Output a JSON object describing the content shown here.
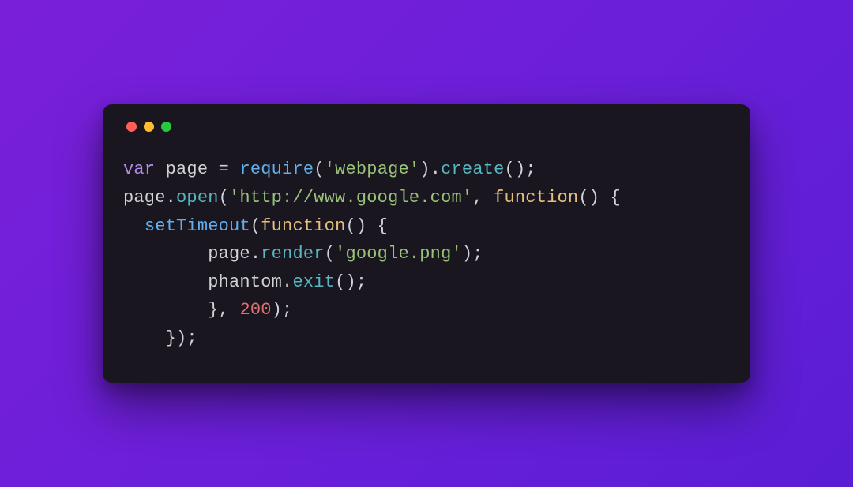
{
  "colors": {
    "background_gradient_from": "#7a1fd9",
    "background_gradient_to": "#5a1dd4",
    "window_bg": "#1a161f",
    "traffic_red": "#ff5f57",
    "traffic_yellow": "#febc2e",
    "traffic_green": "#28c840",
    "token_keyword": "#b389ed",
    "token_ident": "#d0d2d6",
    "token_method": "#56b6c2",
    "token_builtin": "#61afef",
    "token_fnword": "#e5c07b",
    "token_string": "#98c379",
    "token_number": "#d8716f",
    "token_punc": "#cfd2d8"
  },
  "code": {
    "language": "javascript",
    "lines": [
      [
        {
          "t": "keyword",
          "v": "var"
        },
        {
          "t": "punc",
          "v": " "
        },
        {
          "t": "ident",
          "v": "page"
        },
        {
          "t": "punc",
          "v": " "
        },
        {
          "t": "punc",
          "v": "="
        },
        {
          "t": "punc",
          "v": " "
        },
        {
          "t": "builtin",
          "v": "require"
        },
        {
          "t": "punc",
          "v": "("
        },
        {
          "t": "string",
          "v": "'webpage'"
        },
        {
          "t": "punc",
          "v": ")"
        },
        {
          "t": "punc",
          "v": "."
        },
        {
          "t": "method",
          "v": "create"
        },
        {
          "t": "punc",
          "v": "();"
        }
      ],
      [
        {
          "t": "ident",
          "v": "page"
        },
        {
          "t": "punc",
          "v": "."
        },
        {
          "t": "method",
          "v": "open"
        },
        {
          "t": "punc",
          "v": "("
        },
        {
          "t": "string",
          "v": "'http://www.google.com'"
        },
        {
          "t": "punc",
          "v": ", "
        },
        {
          "t": "fnword",
          "v": "function"
        },
        {
          "t": "punc",
          "v": "() {"
        }
      ],
      [
        {
          "t": "punc",
          "v": "  "
        },
        {
          "t": "method2",
          "v": "setTimeout"
        },
        {
          "t": "punc",
          "v": "("
        },
        {
          "t": "fnword",
          "v": "function"
        },
        {
          "t": "punc",
          "v": "() {"
        }
      ],
      [
        {
          "t": "punc",
          "v": "        "
        },
        {
          "t": "ident",
          "v": "page"
        },
        {
          "t": "punc",
          "v": "."
        },
        {
          "t": "method",
          "v": "render"
        },
        {
          "t": "punc",
          "v": "("
        },
        {
          "t": "string",
          "v": "'google.png'"
        },
        {
          "t": "punc",
          "v": ");"
        }
      ],
      [
        {
          "t": "punc",
          "v": "        "
        },
        {
          "t": "ident",
          "v": "phantom"
        },
        {
          "t": "punc",
          "v": "."
        },
        {
          "t": "method",
          "v": "exit"
        },
        {
          "t": "punc",
          "v": "();"
        }
      ],
      [
        {
          "t": "punc",
          "v": "        }, "
        },
        {
          "t": "number",
          "v": "200"
        },
        {
          "t": "punc",
          "v": ");"
        }
      ],
      [
        {
          "t": "punc",
          "v": "    });"
        }
      ]
    ]
  }
}
